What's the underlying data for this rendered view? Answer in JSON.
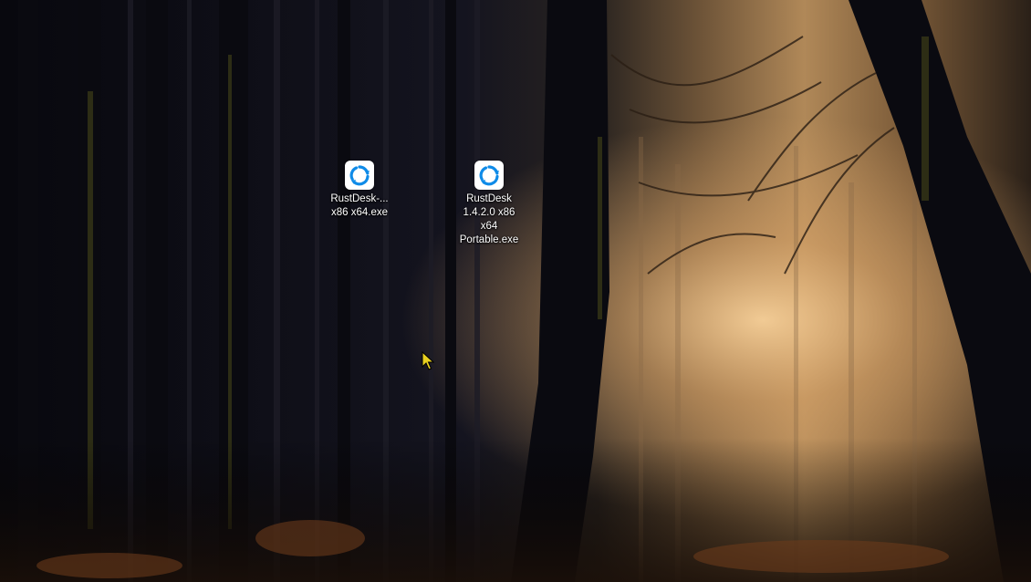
{
  "desktop": {
    "icons": [
      {
        "name": "rustdesk-installer",
        "icon": "rustdesk-icon",
        "label_lines": [
          "RustDesk-...",
          "x86 x64.exe"
        ]
      },
      {
        "name": "rustdesk-portable",
        "icon": "rustdesk-icon",
        "label_lines": [
          "RustDesk",
          "1.4.2.0 x86",
          "x64",
          "Portable.exe"
        ]
      }
    ]
  },
  "cursor": {
    "icon": "arrow-cursor-icon",
    "color": "#e8d020"
  },
  "colors": {
    "rustdesk_blue": "#0f8be8",
    "wallpaper_dark": "#0c0c14",
    "wallpaper_glow": "#e8b878"
  }
}
